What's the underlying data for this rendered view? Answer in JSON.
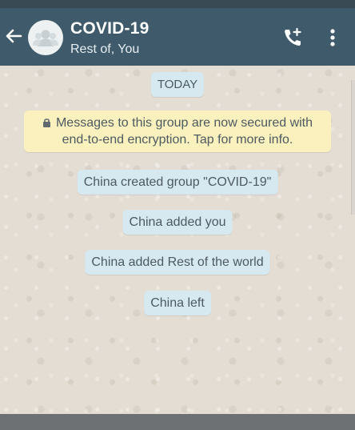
{
  "header": {
    "title": "COVID-19",
    "subtitle": "Rest of, You",
    "background_color": "#3e5a6b",
    "icons": {
      "back": "arrow-left-icon",
      "avatar": "group-avatar-icon",
      "call": "add-call-icon",
      "menu": "more-vertical-icon"
    }
  },
  "chat": {
    "date_label": "TODAY",
    "encryption_notice": {
      "line1": "Messages to this group are now secured with",
      "line2": "end-to-end encryption. Tap for more info.",
      "icon": "lock-icon",
      "background_color": "#faf1bf"
    },
    "system_messages": [
      "China created group \"COVID-19\"",
      "China added you",
      "China added Rest of the world",
      "China left"
    ],
    "pill_color": "#d6e9f1"
  }
}
